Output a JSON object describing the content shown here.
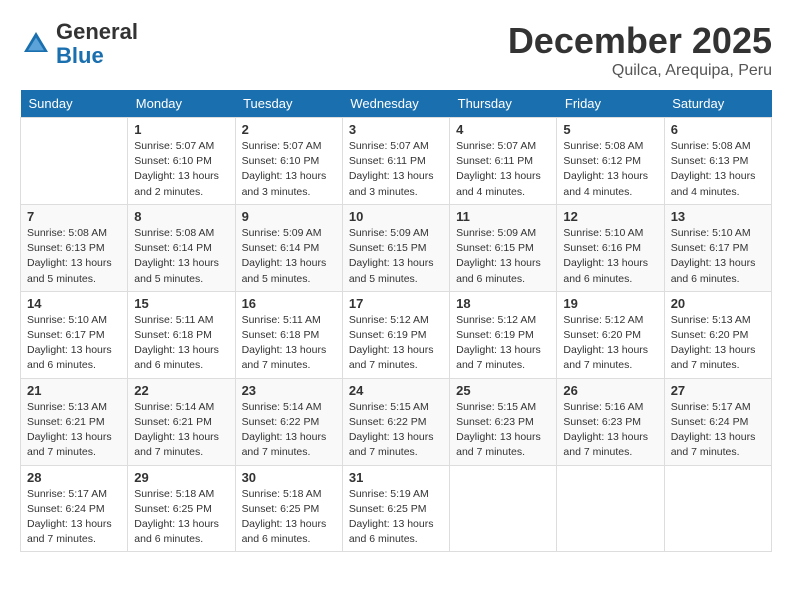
{
  "header": {
    "logo_general": "General",
    "logo_blue": "Blue",
    "month": "December 2025",
    "location": "Quilca, Arequipa, Peru"
  },
  "days_of_week": [
    "Sunday",
    "Monday",
    "Tuesday",
    "Wednesday",
    "Thursday",
    "Friday",
    "Saturday"
  ],
  "weeks": [
    [
      {
        "day": "",
        "info": ""
      },
      {
        "day": "1",
        "info": "Sunrise: 5:07 AM\nSunset: 6:10 PM\nDaylight: 13 hours\nand 2 minutes."
      },
      {
        "day": "2",
        "info": "Sunrise: 5:07 AM\nSunset: 6:10 PM\nDaylight: 13 hours\nand 3 minutes."
      },
      {
        "day": "3",
        "info": "Sunrise: 5:07 AM\nSunset: 6:11 PM\nDaylight: 13 hours\nand 3 minutes."
      },
      {
        "day": "4",
        "info": "Sunrise: 5:07 AM\nSunset: 6:11 PM\nDaylight: 13 hours\nand 4 minutes."
      },
      {
        "day": "5",
        "info": "Sunrise: 5:08 AM\nSunset: 6:12 PM\nDaylight: 13 hours\nand 4 minutes."
      },
      {
        "day": "6",
        "info": "Sunrise: 5:08 AM\nSunset: 6:13 PM\nDaylight: 13 hours\nand 4 minutes."
      }
    ],
    [
      {
        "day": "7",
        "info": "Sunrise: 5:08 AM\nSunset: 6:13 PM\nDaylight: 13 hours\nand 5 minutes."
      },
      {
        "day": "8",
        "info": "Sunrise: 5:08 AM\nSunset: 6:14 PM\nDaylight: 13 hours\nand 5 minutes."
      },
      {
        "day": "9",
        "info": "Sunrise: 5:09 AM\nSunset: 6:14 PM\nDaylight: 13 hours\nand 5 minutes."
      },
      {
        "day": "10",
        "info": "Sunrise: 5:09 AM\nSunset: 6:15 PM\nDaylight: 13 hours\nand 5 minutes."
      },
      {
        "day": "11",
        "info": "Sunrise: 5:09 AM\nSunset: 6:15 PM\nDaylight: 13 hours\nand 6 minutes."
      },
      {
        "day": "12",
        "info": "Sunrise: 5:10 AM\nSunset: 6:16 PM\nDaylight: 13 hours\nand 6 minutes."
      },
      {
        "day": "13",
        "info": "Sunrise: 5:10 AM\nSunset: 6:17 PM\nDaylight: 13 hours\nand 6 minutes."
      }
    ],
    [
      {
        "day": "14",
        "info": "Sunrise: 5:10 AM\nSunset: 6:17 PM\nDaylight: 13 hours\nand 6 minutes."
      },
      {
        "day": "15",
        "info": "Sunrise: 5:11 AM\nSunset: 6:18 PM\nDaylight: 13 hours\nand 6 minutes."
      },
      {
        "day": "16",
        "info": "Sunrise: 5:11 AM\nSunset: 6:18 PM\nDaylight: 13 hours\nand 7 minutes."
      },
      {
        "day": "17",
        "info": "Sunrise: 5:12 AM\nSunset: 6:19 PM\nDaylight: 13 hours\nand 7 minutes."
      },
      {
        "day": "18",
        "info": "Sunrise: 5:12 AM\nSunset: 6:19 PM\nDaylight: 13 hours\nand 7 minutes."
      },
      {
        "day": "19",
        "info": "Sunrise: 5:12 AM\nSunset: 6:20 PM\nDaylight: 13 hours\nand 7 minutes."
      },
      {
        "day": "20",
        "info": "Sunrise: 5:13 AM\nSunset: 6:20 PM\nDaylight: 13 hours\nand 7 minutes."
      }
    ],
    [
      {
        "day": "21",
        "info": "Sunrise: 5:13 AM\nSunset: 6:21 PM\nDaylight: 13 hours\nand 7 minutes."
      },
      {
        "day": "22",
        "info": "Sunrise: 5:14 AM\nSunset: 6:21 PM\nDaylight: 13 hours\nand 7 minutes."
      },
      {
        "day": "23",
        "info": "Sunrise: 5:14 AM\nSunset: 6:22 PM\nDaylight: 13 hours\nand 7 minutes."
      },
      {
        "day": "24",
        "info": "Sunrise: 5:15 AM\nSunset: 6:22 PM\nDaylight: 13 hours\nand 7 minutes."
      },
      {
        "day": "25",
        "info": "Sunrise: 5:15 AM\nSunset: 6:23 PM\nDaylight: 13 hours\nand 7 minutes."
      },
      {
        "day": "26",
        "info": "Sunrise: 5:16 AM\nSunset: 6:23 PM\nDaylight: 13 hours\nand 7 minutes."
      },
      {
        "day": "27",
        "info": "Sunrise: 5:17 AM\nSunset: 6:24 PM\nDaylight: 13 hours\nand 7 minutes."
      }
    ],
    [
      {
        "day": "28",
        "info": "Sunrise: 5:17 AM\nSunset: 6:24 PM\nDaylight: 13 hours\nand 7 minutes."
      },
      {
        "day": "29",
        "info": "Sunrise: 5:18 AM\nSunset: 6:25 PM\nDaylight: 13 hours\nand 6 minutes."
      },
      {
        "day": "30",
        "info": "Sunrise: 5:18 AM\nSunset: 6:25 PM\nDaylight: 13 hours\nand 6 minutes."
      },
      {
        "day": "31",
        "info": "Sunrise: 5:19 AM\nSunset: 6:25 PM\nDaylight: 13 hours\nand 6 minutes."
      },
      {
        "day": "",
        "info": ""
      },
      {
        "day": "",
        "info": ""
      },
      {
        "day": "",
        "info": ""
      }
    ]
  ]
}
